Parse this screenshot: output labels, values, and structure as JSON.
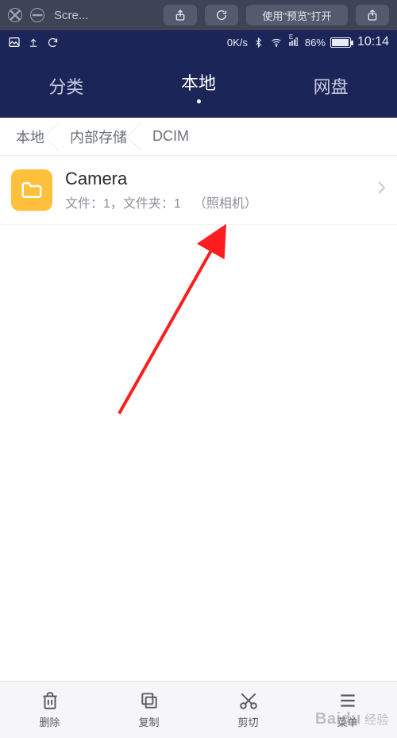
{
  "mac_toolbar": {
    "title": "Scre...",
    "open_label": "使用\"预览\"打开"
  },
  "status_bar": {
    "speed": "0K/s",
    "battery_pct": "86%",
    "time": "10:14"
  },
  "tabs": {
    "items": [
      {
        "label": "分类",
        "active": false
      },
      {
        "label": "本地",
        "active": true
      },
      {
        "label": "网盘",
        "active": false
      }
    ]
  },
  "breadcrumb": {
    "items": [
      "本地",
      "内部存储",
      "DCIM"
    ]
  },
  "list": {
    "items": [
      {
        "title": "Camera",
        "sub_count": "文件：1，文件夹：1",
        "sub_note": "（照相机）"
      }
    ]
  },
  "bottom_bar": {
    "delete": "删除",
    "copy": "复制",
    "cut": "剪切",
    "menu": "菜单"
  },
  "watermark": {
    "brand": "Baidu",
    "suffix": "经验"
  }
}
